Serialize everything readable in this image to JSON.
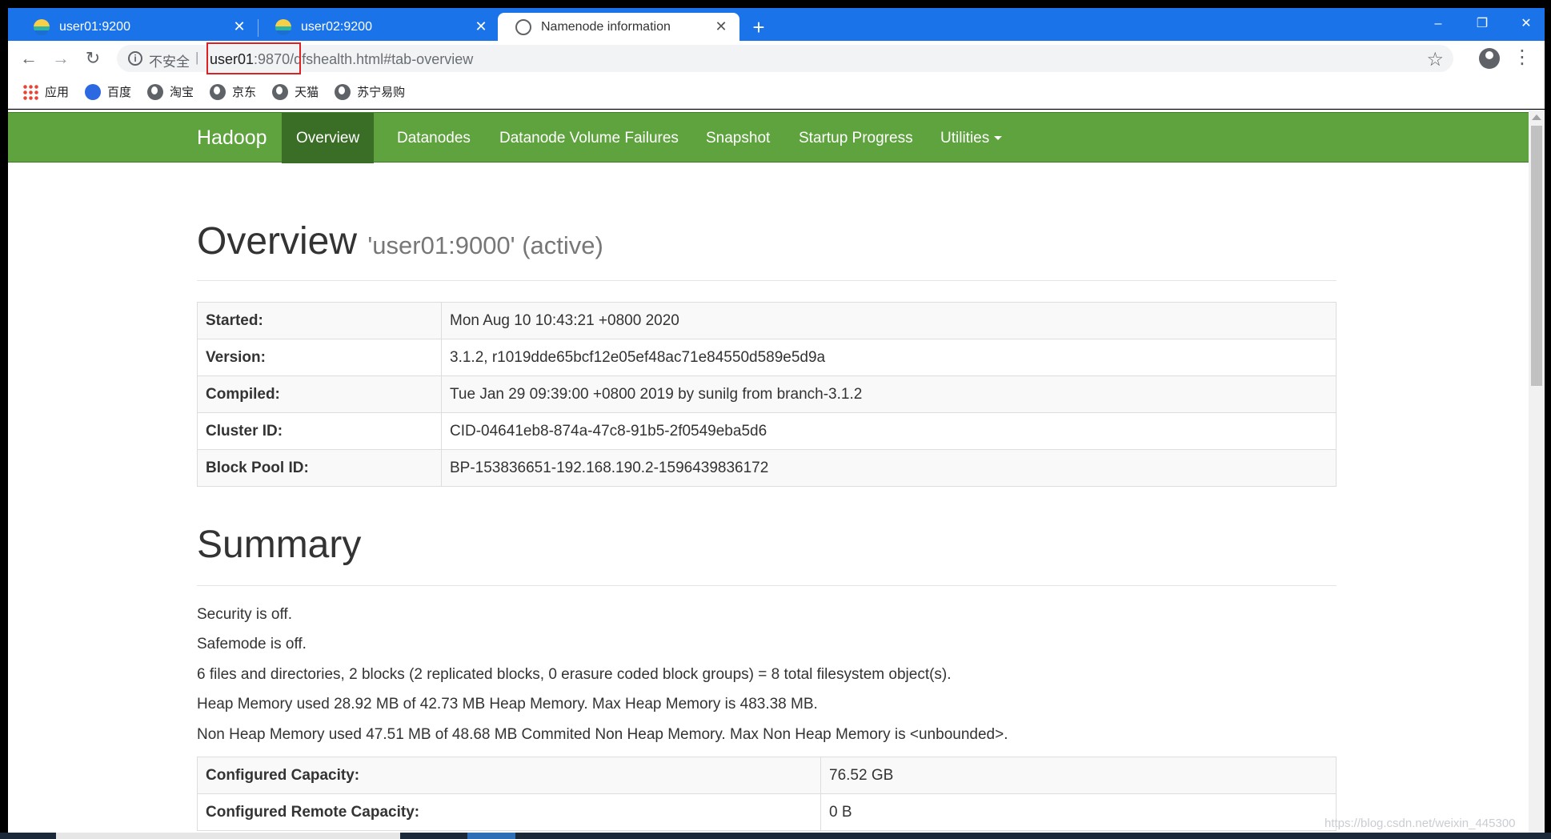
{
  "browser": {
    "tabs": [
      {
        "title": "user01:9200",
        "active": false
      },
      {
        "title": "user02:9200",
        "active": false
      },
      {
        "title": "Namenode information",
        "active": true
      }
    ],
    "new_tab": "+",
    "close_glyph": "✕",
    "window_controls": {
      "minimize": "–",
      "restore": "❐",
      "close": "✕"
    },
    "nav": {
      "back": "←",
      "forward": "→",
      "reload": "↻"
    },
    "security_label": "不安全",
    "url": {
      "host": "user01",
      "port": ":9870",
      "path": "/dfshealth.html#tab-overview"
    },
    "star": "☆",
    "menu": "⋮",
    "bookmarks": [
      "应用",
      "百度",
      "淘宝",
      "京东",
      "天猫",
      "苏宁易购"
    ]
  },
  "hadoop_nav": {
    "brand": "Hadoop",
    "items": [
      "Overview",
      "Datanodes",
      "Datanode Volume Failures",
      "Snapshot",
      "Startup Progress",
      "Utilities"
    ],
    "active": "Overview"
  },
  "overview": {
    "title": "Overview",
    "subtitle": "'user01:9000' (active)",
    "rows": [
      {
        "key": "Started:",
        "value": "Mon Aug 10 10:43:21 +0800 2020"
      },
      {
        "key": "Version:",
        "value": "3.1.2, r1019dde65bcf12e05ef48ac71e84550d589e5d9a"
      },
      {
        "key": "Compiled:",
        "value": "Tue Jan 29 09:39:00 +0800 2019 by sunilg from branch-3.1.2"
      },
      {
        "key": "Cluster ID:",
        "value": "CID-04641eb8-874a-47c8-91b5-2f0549eba5d6"
      },
      {
        "key": "Block Pool ID:",
        "value": "BP-153836651-192.168.190.2-1596439836172"
      }
    ]
  },
  "summary": {
    "title": "Summary",
    "lines": [
      "Security is off.",
      "Safemode is off.",
      "6 files and directories, 2 blocks (2 replicated blocks, 0 erasure coded block groups) = 8 total filesystem object(s).",
      "Heap Memory used 28.92 MB of 42.73 MB Heap Memory. Max Heap Memory is 483.38 MB.",
      "Non Heap Memory used 47.51 MB of 48.68 MB Commited Non Heap Memory. Max Non Heap Memory is <unbounded>."
    ],
    "capacity_rows": [
      {
        "key": "Configured Capacity:",
        "value": "76.52 GB"
      },
      {
        "key": "Configured Remote Capacity:",
        "value": "0 B"
      }
    ]
  },
  "watermark": "https://blog.csdn.net/weixin_445300",
  "icons": {
    "tab_favicon": "elasticsearch-icon",
    "active_favicon": "globe-icon",
    "info": "info-icon",
    "avatar": "account-icon"
  }
}
